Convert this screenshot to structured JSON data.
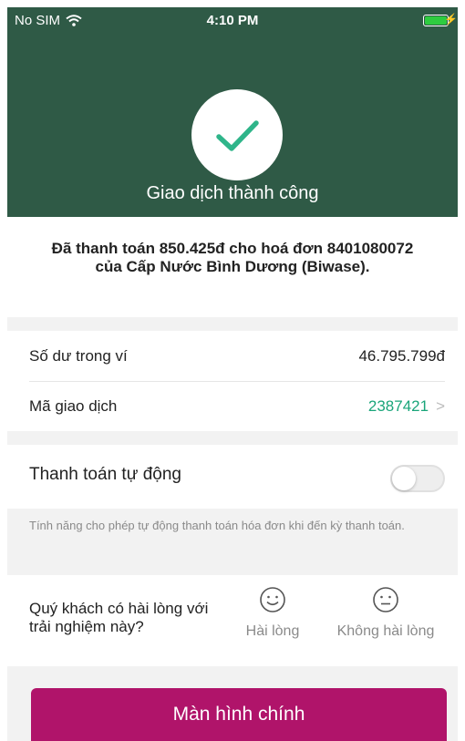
{
  "status_bar": {
    "carrier": "No SIM",
    "time": "4:10 PM",
    "wifi_icon": "wifi-icon",
    "battery_icon": "battery-icon",
    "charging_icon": "charging-bolt-icon"
  },
  "header": {
    "success_icon": "check-icon",
    "title": "Giao dịch thành công",
    "background_color": "#2f5a46",
    "check_color": "#2fb58a"
  },
  "payment_message": "Đã thanh toán 850.425đ cho hoá đơn 8401080072 của Cấp Nước Bình Dương (Biwase).",
  "info": {
    "balance_label": "Số dư trong ví",
    "balance_value": "46.795.799đ",
    "transaction_label": "Mã giao dịch",
    "transaction_value": "2387421",
    "transaction_icon": "chevron-right-icon"
  },
  "auto_pay": {
    "label": "Thanh toán tự động",
    "enabled": false,
    "note": "Tính năng cho phép tự động thanh toán hóa đơn khi đến kỳ thanh toán."
  },
  "feedback": {
    "question": "Quý khách có hài lòng với trải nghiệm này?",
    "options": [
      {
        "label": "Hài lòng",
        "icon": "smile-icon"
      },
      {
        "label": "Không hài lòng",
        "icon": "neutral-face-icon"
      }
    ]
  },
  "main_button": {
    "label": "Màn hình chính",
    "color": "#b0146a"
  }
}
